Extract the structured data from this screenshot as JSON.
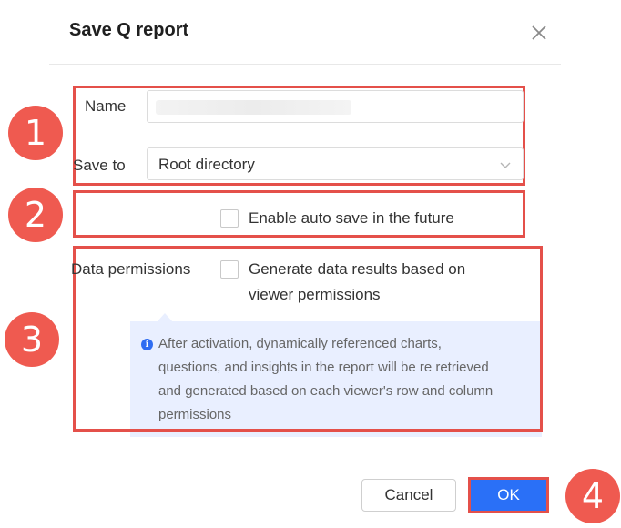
{
  "dialog": {
    "title": "Save Q report",
    "name_label": "Name",
    "name_value": "",
    "save_to_label": "Save to",
    "save_to_value": "Root directory",
    "auto_save_label": "Enable auto save in the future",
    "data_permissions_label": "Data permissions",
    "generate_line1": "Generate data results based on",
    "generate_line2": "viewer permissions",
    "info_lines": [
      "After activation, dynamically referenced charts,",
      "questions, and insights in the report will be re retrieved",
      "and generated based on each viewer's row and column",
      "permissions"
    ],
    "cancel_label": "Cancel",
    "ok_label": "OK"
  },
  "annotations": [
    "1",
    "2",
    "3",
    "4"
  ],
  "colors": {
    "accent": "#2a70f7",
    "highlight": "#e4504a",
    "info_bg": "#e9efff"
  },
  "icons": {
    "close": "close-icon",
    "dropdown": "chevron-down-icon",
    "info": "info-icon"
  }
}
